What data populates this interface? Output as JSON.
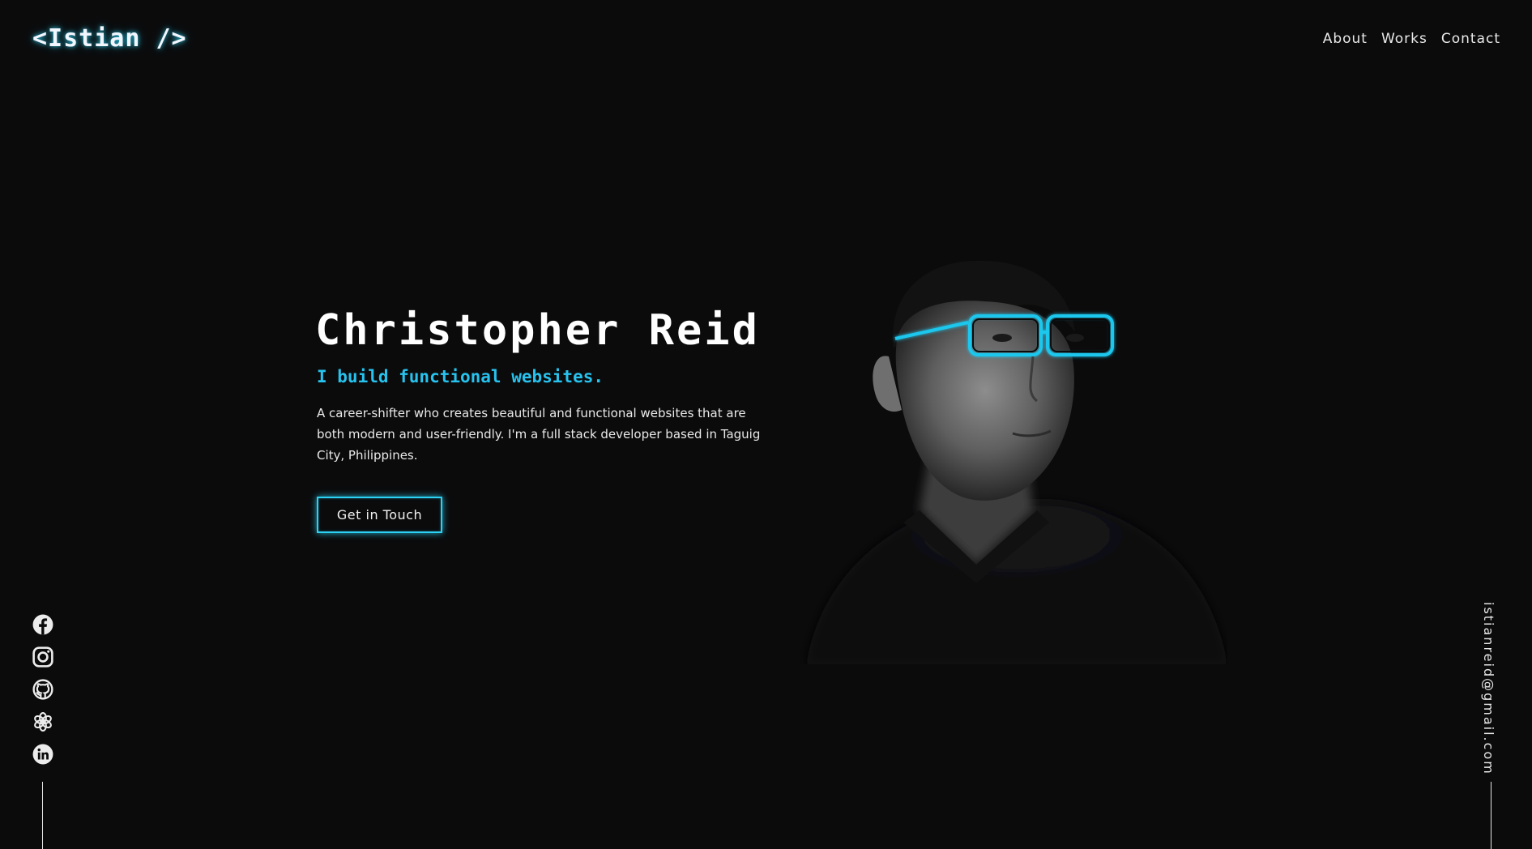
{
  "header": {
    "logo": "<Istian />",
    "nav": [
      {
        "label": "About"
      },
      {
        "label": "Works"
      },
      {
        "label": "Contact"
      }
    ]
  },
  "hero": {
    "name": "Christopher Reid",
    "tagline": "I build functional websites.",
    "description": "A career-shifter who creates beautiful and functional websites that are both modern and user-friendly. I'm a full stack developer based in Taguig City, Philippines.",
    "cta_label": "Get in Touch"
  },
  "socials": [
    {
      "icon": "facebook-icon"
    },
    {
      "icon": "instagram-icon"
    },
    {
      "icon": "github-icon"
    },
    {
      "icon": "openai-icon"
    },
    {
      "icon": "linkedin-icon"
    }
  ],
  "email": "istianreid@gmail.com",
  "colors": {
    "background": "#0b0b0c",
    "accent": "#27c3ee",
    "text": "#e9e9e9"
  }
}
